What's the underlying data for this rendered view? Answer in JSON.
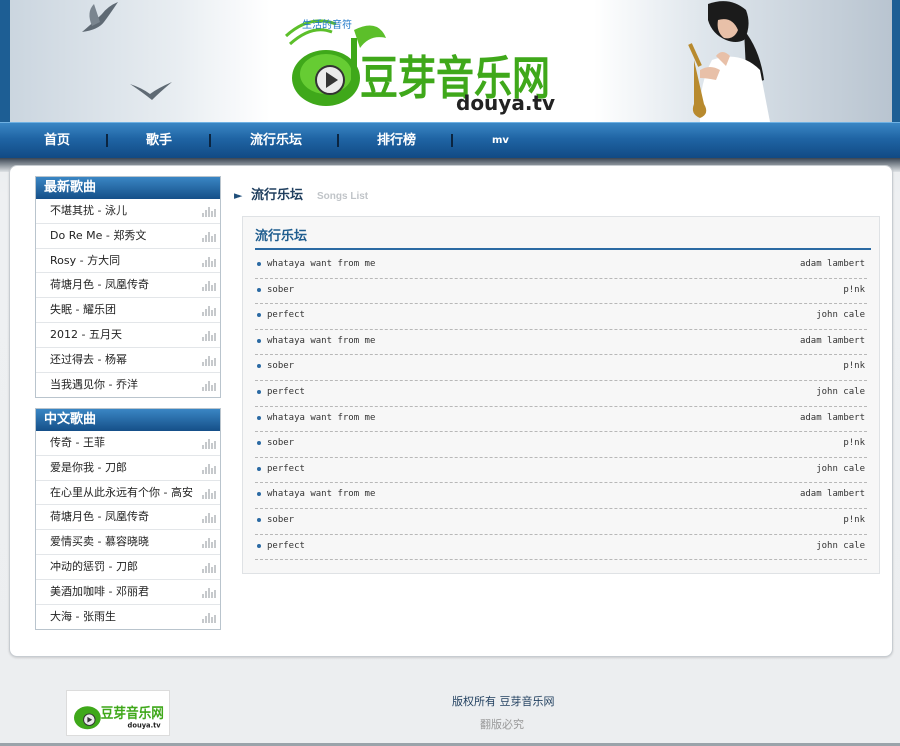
{
  "brand": {
    "slogan": "生活的音符",
    "name": "豆芽音乐网",
    "domain": "douya.tv"
  },
  "nav": [
    {
      "label": "首页"
    },
    {
      "label": "歌手"
    },
    {
      "label": "流行乐坛"
    },
    {
      "label": "排行榜"
    },
    {
      "label": "mv"
    }
  ],
  "sidebar": {
    "latest": {
      "title": "最新歌曲",
      "items": [
        "不堪其扰 - 泳儿",
        "Do Re Me - 郑秀文",
        "Rosy - 方大同",
        "荷塘月色 - 凤凰传奇",
        "失眠 - 耀乐团",
        "2012 - 五月天",
        "还过得去 - 杨幂",
        "当我遇见你 - 乔洋"
      ]
    },
    "chinese": {
      "title": "中文歌曲",
      "items": [
        "传奇 - 王菲",
        "爱是你我 - 刀郎",
        "在心里从此永远有个你 - 高安",
        "荷塘月色 - 凤凰传奇",
        "爱情买卖 - 慕容晓晓",
        "冲动的惩罚 - 刀郎",
        "美酒加咖啡 - 邓丽君",
        "大海 - 张雨生"
      ]
    }
  },
  "content": {
    "section_title": "流行乐坛",
    "section_subtitle": "Songs List",
    "list_title": "流行乐坛",
    "songs": [
      {
        "name": "whataya want from me",
        "artist": "adam lambert"
      },
      {
        "name": "sober",
        "artist": "p!nk"
      },
      {
        "name": "perfect",
        "artist": "john cale"
      },
      {
        "name": "whataya want from me",
        "artist": "adam lambert"
      },
      {
        "name": "sober",
        "artist": "p!nk"
      },
      {
        "name": "perfect",
        "artist": "john cale"
      },
      {
        "name": "whataya want from me",
        "artist": "adam lambert"
      },
      {
        "name": "sober",
        "artist": "p!nk"
      },
      {
        "name": "perfect",
        "artist": "john cale"
      },
      {
        "name": "whataya want from me",
        "artist": "adam lambert"
      },
      {
        "name": "sober",
        "artist": "p!nk"
      },
      {
        "name": "perfect",
        "artist": "john cale"
      }
    ]
  },
  "footer": {
    "copyright": "版权所有 豆芽音乐网",
    "rights": "翻版必究"
  },
  "colors": {
    "nav_blue": "#1f64a4",
    "logo_green": "#4caf1e",
    "logo_blue": "#1f78c8"
  }
}
